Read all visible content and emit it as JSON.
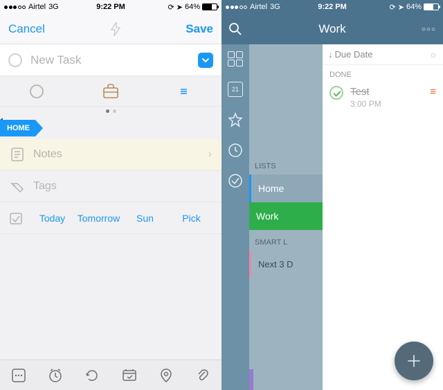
{
  "status": {
    "carrier": "Airtel",
    "network": "3G",
    "time": "9:22 PM",
    "battery": "64%"
  },
  "left": {
    "cancel": "Cancel",
    "save": "Save",
    "newtask_placeholder": "New Task",
    "home_tag": "HOME",
    "notes": "Notes",
    "tags": "Tags",
    "date_opts": {
      "today": "Today",
      "tomorrow": "Tomorrow",
      "sun": "Sun",
      "pick": "Pick"
    }
  },
  "right": {
    "title": "Work",
    "sort_label": "Due Date",
    "calendar_day": "21",
    "sections": {
      "lists": "LISTS",
      "smart": "SMART L",
      "done": "DONE"
    },
    "lists": {
      "home": "Home",
      "work": "Work",
      "next": "Next 3 D"
    },
    "task": {
      "title": "Test",
      "time": "3:00 PM"
    }
  }
}
